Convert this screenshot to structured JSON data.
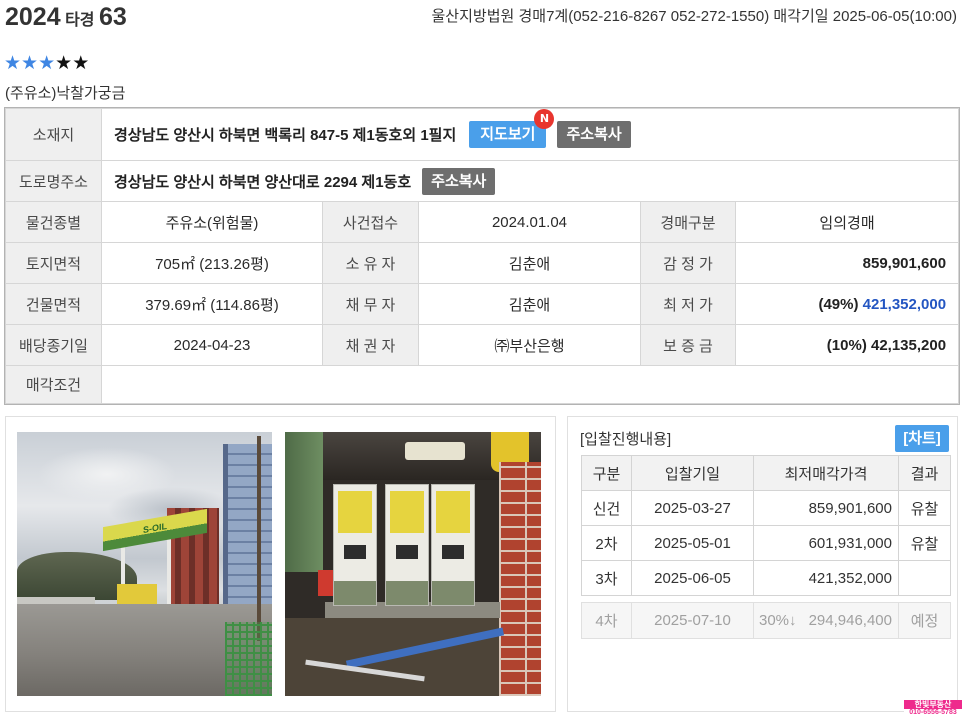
{
  "header": {
    "year": "2024",
    "case_type": "타경",
    "case_no": "63",
    "court_info": "울산지방법원 경매7계(052-216-8267 052-272-1550) 매각기일 2025-06-05(10:00)"
  },
  "rating": {
    "value": 3,
    "max": 5,
    "glyph": "★"
  },
  "memo": "(주유소)낙찰가궁금",
  "info": {
    "location": {
      "label": "소재지",
      "value": "경상남도 양산시 하북면 백록리 847-5 제1동호외 1필지",
      "map_button": "지도보기",
      "badge": "N",
      "copy_button": "주소복사"
    },
    "road_address": {
      "label": "도로명주소",
      "value": "경상남도 양산시 하북면 양산대로 2294 제1동호",
      "copy_button": "주소복사"
    },
    "property_type": {
      "label": "물건종별",
      "value": "주유소(위험물)"
    },
    "case_received": {
      "label": "사건접수",
      "value": "2024.01.04"
    },
    "auction_type": {
      "label": "경매구분",
      "value": "임의경매"
    },
    "land_area": {
      "label": "토지면적",
      "value": "705㎡ (213.26평)"
    },
    "owner": {
      "label": "소 유 자",
      "value": "김춘애"
    },
    "appraisal": {
      "label": "감 정 가",
      "value": "859,901,600"
    },
    "building_area": {
      "label": "건물면적",
      "value": "379.69㎡ (114.86평)"
    },
    "debtor": {
      "label": "채 무 자",
      "value": "김춘애"
    },
    "minimum_price": {
      "label": "최 저 가",
      "percent": "(49%)",
      "value": "421,352,000"
    },
    "claim_deadline": {
      "label": "배당종기일",
      "value": "2024-04-23"
    },
    "creditor": {
      "label": "채 권 자",
      "value": "㈜부산은행"
    },
    "deposit": {
      "label": "보 증 금",
      "percent": "(10%)",
      "value": "42,135,200"
    },
    "sale_conditions": {
      "label": "매각조건",
      "value": ""
    }
  },
  "photos": {
    "exterior_sign": "S-OIL"
  },
  "bidding": {
    "title": "[입찰진행내용]",
    "chart_button": "[차트]",
    "headers": [
      "구분",
      "입찰기일",
      "최저매각가격",
      "결과"
    ],
    "rounds": [
      {
        "round": "신건",
        "date": "2025-03-27",
        "price": "859,901,600",
        "result": "유찰"
      },
      {
        "round": "2차",
        "date": "2025-05-01",
        "price": "601,931,000",
        "result": "유찰"
      },
      {
        "round": "3차",
        "date": "2025-06-05",
        "price": "421,352,000",
        "result": ""
      }
    ],
    "next": {
      "round": "4차",
      "date": "2025-07-10",
      "reduction": "30%↓",
      "price": "294,946,400",
      "result": "예정"
    }
  },
  "watermark": {
    "name": "한빛부동산",
    "phone": "010-6556-5783"
  },
  "colors": {
    "accent_blue": "#4a9fea",
    "star_blue": "#3f86e3",
    "badge_red": "#e8352e",
    "button_gray": "#6e6e6e",
    "label_bg": "#efefef",
    "grid": "#d6d6d6",
    "price_blue": "#2456c2",
    "logo_pink": "#ee2a8c"
  }
}
